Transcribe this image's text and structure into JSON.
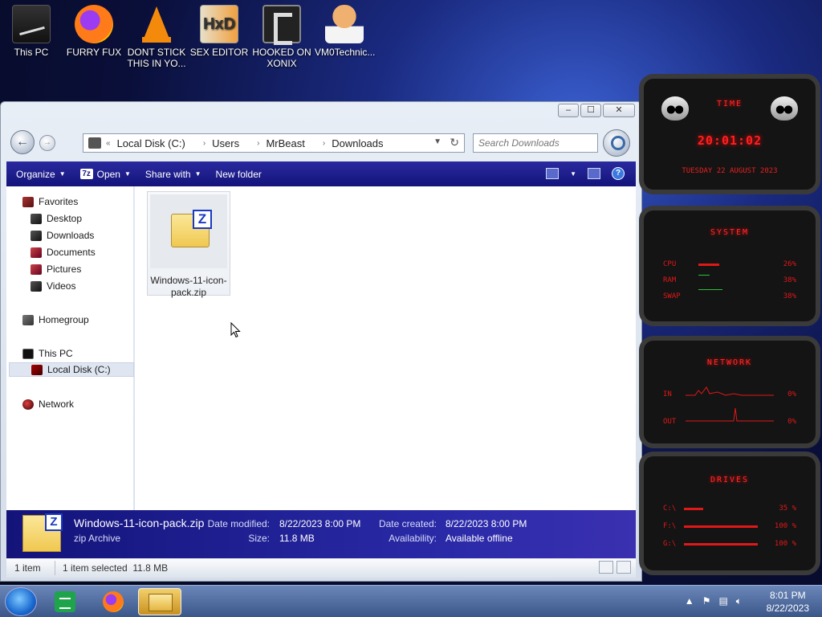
{
  "desktop": {
    "icons": [
      {
        "label": "This PC"
      },
      {
        "label": "FURRY FUX"
      },
      {
        "label": "DONT STICK THIS IN YO..."
      },
      {
        "label": "SEX EDITOR"
      },
      {
        "label": "HOOKED ON XONIX"
      },
      {
        "label": "VM0Technic..."
      }
    ]
  },
  "window": {
    "controls": {
      "minimize": "‒",
      "maximize": "☐",
      "close": "✕"
    },
    "address": {
      "overflow": "«",
      "crumbs": [
        "Local Disk (C:)",
        "Users",
        "MrBeast",
        "Downloads"
      ]
    },
    "search": {
      "placeholder": "Search Downloads"
    },
    "toolbar": {
      "organize": "Organize",
      "open": "Open",
      "share_with": "Share with",
      "new_folder": "New folder"
    },
    "nav": {
      "favorites": "Favorites",
      "desktop": "Desktop",
      "downloads": "Downloads",
      "documents": "Documents",
      "pictures": "Pictures",
      "videos": "Videos",
      "homegroup": "Homegroup",
      "this_pc": "This PC",
      "local_disk": "Local Disk (C:)",
      "network": "Network"
    },
    "files": [
      {
        "name": "Windows-11-icon-pack.zip"
      }
    ],
    "details": {
      "name": "Windows-11-icon-pack.zip",
      "type": "zip Archive",
      "date_modified_label": "Date modified:",
      "date_modified": "8/22/2023 8:00 PM",
      "size_label": "Size:",
      "size": "11.8 MB",
      "date_created_label": "Date created:",
      "date_created": "8/22/2023 8:00 PM",
      "availability_label": "Availability:",
      "availability": "Available offline"
    },
    "status": {
      "count": "1 item",
      "selected": "1 item selected  11.8 MB"
    }
  },
  "gadgets": {
    "time": {
      "title": "TIME",
      "clock": "20:01:02",
      "date": "TUESDAY 22 AUGUST 2023"
    },
    "system": {
      "title": "SYSTEM",
      "cpu_label": "CPU",
      "cpu": "26%",
      "ram_label": "RAM",
      "ram": "38%",
      "swap_label": "SWAP",
      "swap": "38%"
    },
    "network": {
      "title": "NETWORK",
      "in_label": "IN",
      "in": "0%",
      "out_label": "OUT",
      "out": "0%"
    },
    "drives": {
      "title": "DRIVES",
      "c_label": "C:\\",
      "c": "35 %",
      "f_label": "F:\\",
      "f": "100 %",
      "g_label": "G:\\",
      "g": "100 %"
    }
  },
  "taskbar": {
    "time": "8:01 PM",
    "date": "8/22/2023"
  }
}
